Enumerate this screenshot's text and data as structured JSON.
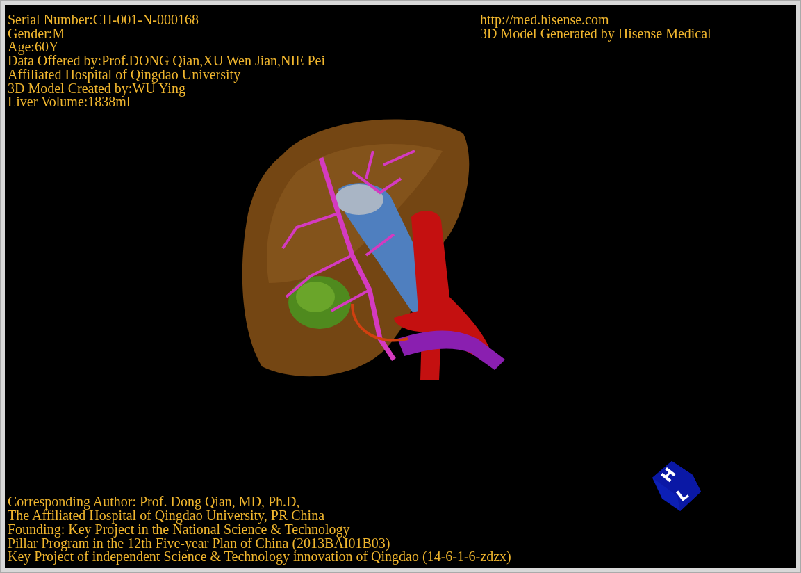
{
  "viewer": {
    "patient_info": [
      "Serial Number:CH-001-N-000168",
      "Gender:M",
      "Age:60Y",
      "Data Offered by:Prof.DONG Qian,XU Wen Jian,NIE Pei",
      "Affiliated Hospital of Qingdao University",
      "3D Model Created by:WU Ying",
      "Liver Volume:1838ml"
    ],
    "source_info": [
      "http://med.hisense.com",
      "3D Model Generated by Hisense Medical"
    ],
    "credits": [
      "Corresponding Author: Prof. Dong Qian, MD, Ph.D,",
      "The Affiliated Hospital of Qingdao University, PR China",
      "Founding: Key Project in the National Science & Technology",
      "Pillar Program in the 12th Five-year Plan of China (2013BAI01B03)",
      "Key Project of independent Science & Technology innovation of Qingdao (14-6-1-6-zdzx)"
    ],
    "orientation_cube": {
      "labels": [
        "H",
        "L"
      ]
    }
  }
}
